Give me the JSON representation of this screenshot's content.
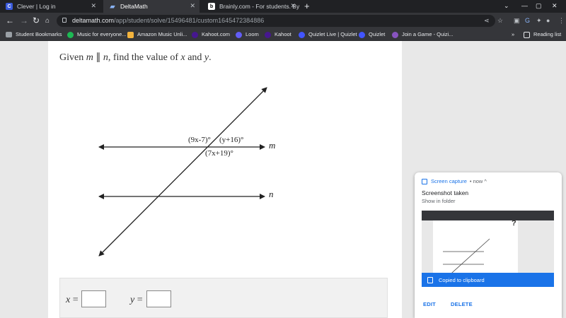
{
  "tabs": [
    {
      "title": "Clever | Log in",
      "favicon": "C",
      "color": "#3b5bdb"
    },
    {
      "title": "DeltaMath",
      "favicon": "D",
      "color": "#2f6bd8"
    },
    {
      "title": "Brainly.com - For students. By stu",
      "favicon": "b",
      "color": "#2b2b2b"
    }
  ],
  "toolbar": {
    "back_icon": "back-arrow-icon",
    "url_host": "deltamath.com",
    "url_path": "/app/student/solve/15496481/custom1645472384886"
  },
  "bookmarks": [
    {
      "label": "Student Bookmarks",
      "color": "#9aa0a6"
    },
    {
      "label": "Music for everyone...",
      "color": "#1db954"
    },
    {
      "label": "Amazon Music Unli...",
      "color": "#f3b33d"
    },
    {
      "label": "Kahoot.com",
      "color": "#46178f"
    },
    {
      "label": "Loom",
      "color": "#625df5"
    },
    {
      "label": "Kahoot",
      "color": "#46178f"
    },
    {
      "label": "Quizlet Live | Quizlet",
      "color": "#4255ff"
    },
    {
      "label": "Quizlet",
      "color": "#4255ff"
    },
    {
      "label": "Join a Game - Quizi...",
      "color": "#8854c0"
    }
  ],
  "bookmarks_overflow": "»",
  "reading_list": "Reading list",
  "problem": {
    "prompt_given": "Given",
    "var_m": "m",
    "parallel": "∥",
    "var_n": "n",
    "prompt_rest": ", find the value of",
    "var_x": "x",
    "and": "and",
    "var_y": "y",
    "period": "."
  },
  "figure": {
    "angle_left": "(9x-7)°",
    "angle_right": "(y+16)°",
    "angle_bottom": "(7x+19)°",
    "line_m": "m",
    "line_n": "n"
  },
  "answers": {
    "x_label": "x",
    "y_label": "y",
    "equals": "=",
    "x_value": "",
    "y_value": ""
  },
  "notification": {
    "app": "Screen capture",
    "time": "• now ^",
    "title": "Screenshot taken",
    "subtitle": "Show in folder",
    "copied": "Copied to clipboard",
    "edit": "EDIT",
    "delete": "DELETE"
  }
}
